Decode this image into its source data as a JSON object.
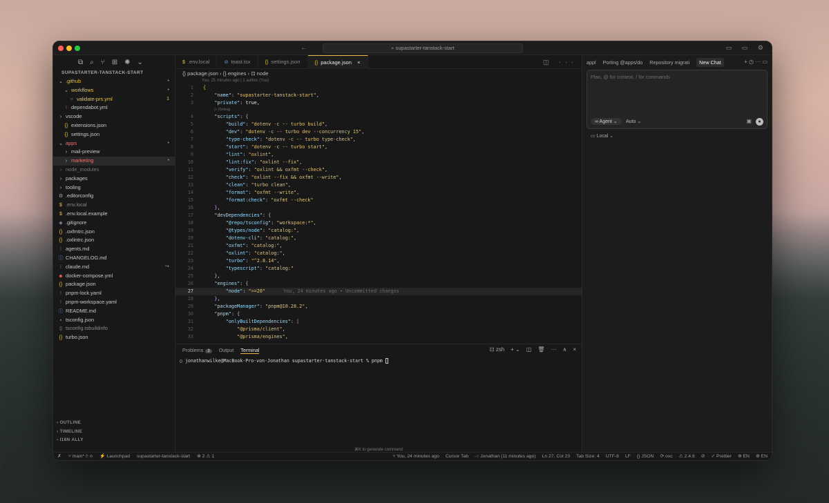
{
  "window": {
    "search_text": "supastarter-tanstack-start",
    "nav_arrows": "← →",
    "right_icons": "▭ ▭ ⚙"
  },
  "sidebar": {
    "icons": [
      "⧉",
      "⌕",
      "⑂",
      "⊞",
      "✺",
      "⌄"
    ],
    "title": "SUPASTARTER-TANSTACK-START",
    "items": [
      {
        "label": ".github",
        "icon": "⌄",
        "icon_color": "#c8c8c8",
        "color": "#e8c34a",
        "indent": 6,
        "badge": "•",
        "badge_color": "#c57a6f"
      },
      {
        "label": "workflows",
        "icon": "⌄",
        "icon_color": "#c8c8c8",
        "color": "#e8c34a",
        "indent": 14,
        "badge": "•",
        "badge_color": "#c57a6f"
      },
      {
        "label": "validate-prs.yml",
        "icon": "⑂",
        "icon_color": "#c57a6f",
        "color": "#e8c34a",
        "indent": 22,
        "badge": "1",
        "badge_color": "#e8c34a"
      },
      {
        "label": "dependabot.yml",
        "icon": "!",
        "icon_color": "#c05a8e",
        "color": "#c8c8c8",
        "indent": 14,
        "badge": "",
        "badge_color": ""
      },
      {
        "label": "vscode",
        "icon": "›",
        "icon_color": "#c8c8c8",
        "color": "#c8c8c8",
        "indent": 6,
        "badge": "",
        "badge_color": ""
      },
      {
        "label": "extensions.json",
        "icon": "{}",
        "icon_color": "#e8c34a",
        "color": "#c8c8c8",
        "indent": 14,
        "badge": "",
        "badge_color": ""
      },
      {
        "label": "settings.json",
        "icon": "{}",
        "icon_color": "#e8c34a",
        "color": "#c8c8c8",
        "indent": 14,
        "badge": "",
        "badge_color": ""
      },
      {
        "label": "apps",
        "icon": "⌄",
        "icon_color": "#c8c8c8",
        "color": "#e07a7a",
        "indent": 6,
        "badge": "•",
        "badge_color": "#c57a6f"
      },
      {
        "label": "mail-preview",
        "icon": "›",
        "icon_color": "#c8c8c8",
        "color": "#c8c8c8",
        "indent": 14,
        "badge": "",
        "badge_color": ""
      },
      {
        "label": "marketing",
        "icon": "›",
        "icon_color": "#c8c8c8",
        "color": "#e07a7a",
        "indent": 14,
        "badge": "•",
        "badge_color": "#c57a6f",
        "selected": true
      },
      {
        "label": "node_modules",
        "icon": "›",
        "icon_color": "#777",
        "color": "#777777",
        "indent": 6,
        "badge": "",
        "badge_color": ""
      },
      {
        "label": "packages",
        "icon": "›",
        "icon_color": "#c8c8c8",
        "color": "#c8c8c8",
        "indent": 6,
        "badge": "",
        "badge_color": ""
      },
      {
        "label": "tooling",
        "icon": "›",
        "icon_color": "#c8c8c8",
        "color": "#c8c8c8",
        "indent": 6,
        "badge": "",
        "badge_color": ""
      },
      {
        "label": ".editorconfig",
        "icon": "⚙",
        "icon_color": "#9aa7b5",
        "color": "#c8c8c8",
        "indent": 6,
        "badge": "",
        "badge_color": ""
      },
      {
        "label": ".env.local",
        "icon": "$",
        "icon_color": "#e8c34a",
        "color": "#8a8a8a",
        "indent": 6,
        "badge": "",
        "badge_color": ""
      },
      {
        "label": ".env.local.example",
        "icon": "$",
        "icon_color": "#e8c34a",
        "color": "#c8c8c8",
        "indent": 6,
        "badge": "",
        "badge_color": ""
      },
      {
        "label": ".gitignore",
        "icon": "◆",
        "icon_color": "#6c7a89",
        "color": "#c8c8c8",
        "indent": 6,
        "badge": "",
        "badge_color": ""
      },
      {
        "label": ".oxfmtrc.json",
        "icon": "{}",
        "icon_color": "#e8c34a",
        "color": "#c8c8c8",
        "indent": 6,
        "badge": "",
        "badge_color": ""
      },
      {
        "label": ".oxlintrc.json",
        "icon": "{}",
        "icon_color": "#e8c34a",
        "color": "#c8c8c8",
        "indent": 6,
        "badge": "",
        "badge_color": ""
      },
      {
        "label": "agents.md",
        "icon": "⁞",
        "icon_color": "#6fb36f",
        "color": "#c8c8c8",
        "indent": 6,
        "badge": "",
        "badge_color": ""
      },
      {
        "label": "CHANGELOG.md",
        "icon": "ⓘ",
        "icon_color": "#6aa0d8",
        "color": "#c8c8c8",
        "indent": 6,
        "badge": "",
        "badge_color": ""
      },
      {
        "label": "claude.md",
        "icon": "⁞",
        "icon_color": "#6fb36f",
        "color": "#c8c8c8",
        "indent": 6,
        "badge": "↪",
        "badge_color": "#999"
      },
      {
        "label": "docker-compose.yml",
        "icon": "◆",
        "icon_color": "#d35a5a",
        "color": "#c8c8c8",
        "indent": 6,
        "badge": "",
        "badge_color": ""
      },
      {
        "label": "package.json",
        "icon": "{}",
        "icon_color": "#e8c34a",
        "color": "#c8c8c8",
        "indent": 6,
        "badge": "",
        "badge_color": ""
      },
      {
        "label": "pnpm-lock.yaml",
        "icon": "!",
        "icon_color": "#c05a8e",
        "color": "#c8c8c8",
        "indent": 6,
        "badge": "",
        "badge_color": ""
      },
      {
        "label": "pnpm-workspace.yaml",
        "icon": "!",
        "icon_color": "#c05a8e",
        "color": "#c8c8c8",
        "indent": 6,
        "badge": "",
        "badge_color": ""
      },
      {
        "label": "README.md",
        "icon": "ⓘ",
        "icon_color": "#6aa0d8",
        "color": "#c8c8c8",
        "indent": 6,
        "badge": "",
        "badge_color": ""
      },
      {
        "label": "tsconfig.json",
        "icon": "▪",
        "icon_color": "#4a8fd8",
        "color": "#c8c8c8",
        "indent": 6,
        "badge": "",
        "badge_color": ""
      },
      {
        "label": "tsconfig.tsbuildinfo",
        "icon": "▯",
        "icon_color": "#aaa",
        "color": "#8a8a8a",
        "indent": 6,
        "badge": "",
        "badge_color": ""
      },
      {
        "label": "turbo.json",
        "icon": "{}",
        "icon_color": "#e8c34a",
        "color": "#c8c8c8",
        "indent": 6,
        "badge": "",
        "badge_color": ""
      }
    ],
    "sections": [
      "› OUTLINE",
      "› TIMELINE",
      "› I18N ALLY"
    ]
  },
  "tabs": [
    {
      "icon": "$",
      "label": ".env.local",
      "active": false
    },
    {
      "icon": "⊘",
      "label": "toast.tsx",
      "active": false
    },
    {
      "icon": "{}",
      "label": "settings.json",
      "active": false
    },
    {
      "icon": "{}",
      "label": "package.json",
      "active": true,
      "close": "×"
    }
  ],
  "tab_actions": "◫ ···",
  "breadcrumb": "{} package.json  ›  {} engines  ›  ⊡ node",
  "blame_header": "You, 25 minutes ago | 1 author (You)",
  "codelens": "▷ Debug",
  "code": [
    {
      "n": "1",
      "html": "<span class='by'>{</span>"
    },
    {
      "n": "2",
      "html": "    <span class='k'>\"name\"</span><span class='p'>: </span><span class='s'>\"supastarter-tanstack-start\"</span><span class='p'>,</span>"
    },
    {
      "n": "3",
      "html": "    <span class='k'>\"private\"</span><span class='p'>: </span><span class='kv'>true</span><span class='p'>,</span>",
      "lens_after": true
    },
    {
      "n": "4",
      "html": "    <span class='k'>\"scripts\"</span><span class='p'>: </span><span class='br'>{</span>"
    },
    {
      "n": "5",
      "html": "        <span class='k'>\"build\"</span><span class='p'>: </span><span class='s'>\"dotenv -c -- turbo build\"</span><span class='p'>,</span>"
    },
    {
      "n": "6",
      "html": "        <span class='k'>\"dev\"</span><span class='p'>: </span><span class='s'>\"dotenv -c -- turbo dev --concurrency 15\"</span><span class='p'>,</span>"
    },
    {
      "n": "7",
      "html": "        <span class='k'>\"type-check\"</span><span class='p'>: </span><span class='s'>\"dotenv -c -- turbo type-check\"</span><span class='p'>,</span>"
    },
    {
      "n": "8",
      "html": "        <span class='k'>\"start\"</span><span class='p'>: </span><span class='s'>\"dotenv -c -- turbo start\"</span><span class='p'>,</span>"
    },
    {
      "n": "9",
      "html": "        <span class='k'>\"lint\"</span><span class='p'>: </span><span class='s'>\"oxlint\"</span><span class='p'>,</span>"
    },
    {
      "n": "10",
      "html": "        <span class='k'>\"lint:fix\"</span><span class='p'>: </span><span class='s'>\"oxlint --fix\"</span><span class='p'>,</span>"
    },
    {
      "n": "11",
      "html": "        <span class='k'>\"verify\"</span><span class='p'>: </span><span class='s'>\"oxlint &amp;&amp; oxfmt --check\"</span><span class='p'>,</span>"
    },
    {
      "n": "12",
      "html": "        <span class='k'>\"check\"</span><span class='p'>: </span><span class='s'>\"oxlint --fix &amp;&amp; oxfmt --write\"</span><span class='p'>,</span>"
    },
    {
      "n": "13",
      "html": "        <span class='k'>\"clean\"</span><span class='p'>: </span><span class='s'>\"turbo clean\"</span><span class='p'>,</span>"
    },
    {
      "n": "14",
      "html": "        <span class='k'>\"format\"</span><span class='p'>: </span><span class='s'>\"oxfmt --write\"</span><span class='p'>,</span>"
    },
    {
      "n": "15",
      "html": "        <span class='k'>\"format:check\"</span><span class='p'>: </span><span class='s'>\"oxfmt --check\"</span>"
    },
    {
      "n": "16",
      "html": "    <span class='br'>}</span><span class='p'>,</span>"
    },
    {
      "n": "17",
      "html": "    <span class='k'>\"devDependencies\"</span><span class='p'>: </span><span class='br'>{</span>"
    },
    {
      "n": "18",
      "html": "        <span class='k'>\"@repo/tsconfig\"</span><span class='p'>: </span><span class='s'>\"workspace:*\"</span><span class='p'>,</span>"
    },
    {
      "n": "19",
      "html": "        <span class='k'>\"@types/node\"</span><span class='p'>: </span><span class='s'>\"catalog:\"</span><span class='p'>,</span>"
    },
    {
      "n": "20",
      "html": "        <span class='k'>\"dotenv-cli\"</span><span class='p'>: </span><span class='s'>\"catalog:\"</span><span class='p'>,</span>"
    },
    {
      "n": "21",
      "html": "        <span class='k'>\"oxfmt\"</span><span class='p'>: </span><span class='s'>\"catalog:\"</span><span class='p'>,</span>"
    },
    {
      "n": "22",
      "html": "        <span class='k'>\"oxlint\"</span><span class='p'>: </span><span class='s'>\"catalog:\"</span><span class='p'>,</span>"
    },
    {
      "n": "23",
      "html": "        <span class='k'>\"turbo\"</span><span class='p'>: </span><span class='s'>\"^2.8.14\"</span><span class='p'>,</span>"
    },
    {
      "n": "24",
      "html": "        <span class='k'>\"typescript\"</span><span class='p'>: </span><span class='s'>\"catalog:\"</span>"
    },
    {
      "n": "25",
      "html": "    <span class='br'>}</span><span class='p'>,</span>"
    },
    {
      "n": "26",
      "html": "    <span class='k'>\"engines\"</span><span class='p'>: </span><span class='br'>{</span>"
    },
    {
      "n": "27",
      "html": "        <span class='k'>\"node\"</span><span class='p'>: </span><span class='s'>\"&gt;=20\"</span><span class='blame-inline'>You, 24 minutes ago • Uncommitted changes</span>",
      "current": true
    },
    {
      "n": "28",
      "html": "    <span class='br'>}</span><span class='p'>,</span>"
    },
    {
      "n": "29",
      "html": "    <span class='k'>\"packageManager\"</span><span class='p'>: </span><span class='s'>\"pnpm@10.28.2\"</span><span class='p'>,</span>"
    },
    {
      "n": "30",
      "html": "    <span class='k'>\"pnpm\"</span><span class='p'>: </span><span class='br'>{</span>"
    },
    {
      "n": "31",
      "html": "        <span class='k'>\"onlyBuiltDependencies\"</span><span class='p'>: </span><span class='s2'>[</span>"
    },
    {
      "n": "32",
      "html": "            <span class='s'>\"@prisma/client\"</span><span class='p'>,</span>"
    },
    {
      "n": "33",
      "html": "            <span class='s'>\"@prisma/engines\"</span><span class='p'>,</span>"
    }
  ],
  "panel": {
    "tabs": [
      "Problems",
      "Output",
      "Terminal"
    ],
    "problems_count": "3",
    "actions": [
      "⊡ zsh",
      "+ ⌄",
      "◫",
      "🗑",
      "···",
      "∧",
      "×"
    ],
    "terminal_line": "○ jonathanwilke@MacBook-Pro-von-Jonathan supastarter-tanstack-start % pnpm ",
    "hint": "⌘K to generate command"
  },
  "chat": {
    "tabs": [
      "appl",
      "Porting @apps/do",
      "Repository migrati",
      "New Chat"
    ],
    "tab_actions": "+ ◷ ··· ▭",
    "placeholder": "Plan, @ for context, / for commands",
    "agent_label": "∞ Agent ⌄",
    "auto_label": "Auto ⌄",
    "image_icon": "▣",
    "mic_icon": "●",
    "local_label": "▭ Local ⌄"
  },
  "status": {
    "left": [
      "✗",
      "⑂ main* ⟳ ◷",
      "⚡ Launchpad",
      "supastarter-tanstack-start",
      "⊗ 2 ⚠ 1"
    ],
    "right": [
      "⑂ You, 24 minutes ago",
      "Cursor Tab",
      "-○ Jonathan (11 minutes ago)",
      "Ln 27, Col 23",
      "Tab Size: 4",
      "UTF-8",
      "LF",
      "{} JSON",
      "⟳ oxc",
      "⚠ 2.4.6",
      "⊘",
      "✓ Prettier",
      "⊕ EN",
      "⊕ EN"
    ]
  }
}
